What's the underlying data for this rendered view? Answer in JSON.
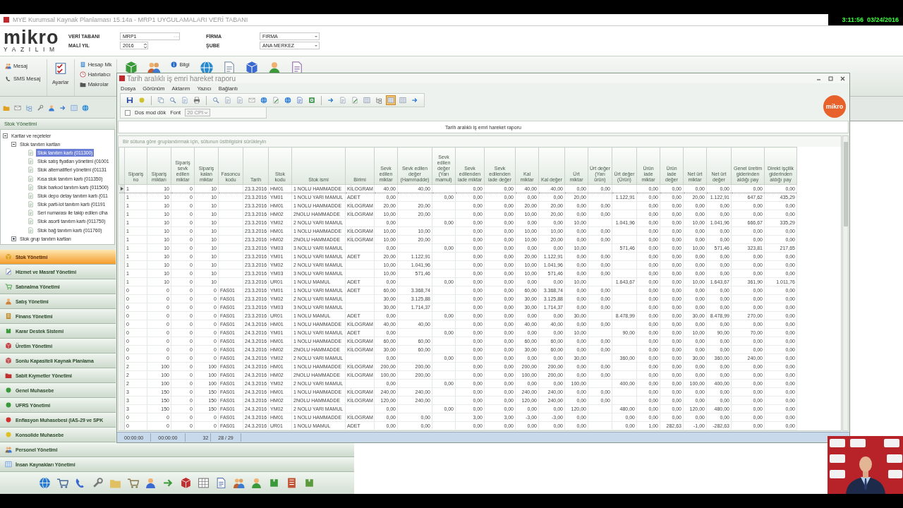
{
  "os_bar": {
    "time": "3:11:56",
    "date": "03/24/2016"
  },
  "window": {
    "title": "MYE Kurumsal Kaynak Planlaması 15.14a - MRP1  UYGULAMALARI VERİ TABANI"
  },
  "logo": {
    "brand": "mikro",
    "tagline": "YAZILIM"
  },
  "header_fields": [
    {
      "label": "VERİ TABANI",
      "value": "MRP1",
      "kind": "browse"
    },
    {
      "label": "MALİ YIL",
      "value": "2016",
      "kind": "spin"
    },
    {
      "label": "FİRMA",
      "value": "FIRMA",
      "kind": "dropdown"
    },
    {
      "label": "ŞUBE",
      "value": "ANA MERKEZ",
      "kind": "dropdown"
    }
  ],
  "ribbon": {
    "messages": [
      {
        "label": "Mesaj"
      },
      {
        "label": "SMS Mesaj"
      }
    ],
    "settings": {
      "label": "Ayarlar"
    },
    "tools": [
      {
        "label": "Hesap Mk"
      },
      {
        "label": "Hatırlatıcı"
      },
      {
        "label": "Makrolar"
      }
    ],
    "info": {
      "label": "Bilgi"
    }
  },
  "sidebar": {
    "title": "Stok Yönetimi",
    "tree": [
      {
        "label": "Kartlar ve reçeteler",
        "expanded": true,
        "children": [
          {
            "label": "Stok tanıtım kartları",
            "expanded": true,
            "children": [
              {
                "label": "Stok tanıtım kartı (011300)",
                "selected": true
              },
              {
                "label": "Stok satış fiyatları yönetimi (01001",
                "selected": false
              },
              {
                "label": "Stok alternatifleri yönetimi (01131",
                "selected": false
              },
              {
                "label": "Kısa stok tanıtım kartı (011350)",
                "selected": false
              },
              {
                "label": "Stok barkod tanıtım kartı (011500)",
                "selected": false
              },
              {
                "label": "Stok depo detay tanıtım kartı (011",
                "selected": false
              },
              {
                "label": "Stok parti-lot tanıtım kartı (01191",
                "selected": false
              },
              {
                "label": "Seri numarası ile takip edilen ciha",
                "selected": false
              },
              {
                "label": "Stok asorti tanıtım kartı (011750)",
                "selected": false
              },
              {
                "label": "Stok bağ tanıtım kartı (011760)",
                "selected": false
              }
            ]
          },
          {
            "label": "Stok grup tanıtım kartları",
            "expanded": false
          }
        ]
      }
    ]
  },
  "nav": {
    "items": [
      {
        "label": "Stok Yönetimi",
        "selected": true
      },
      {
        "label": "Hizmet ve Masraf Yönetimi",
        "selected": false
      },
      {
        "label": "Satınalma Yönetimi",
        "selected": false
      },
      {
        "label": "Satış Yönetimi",
        "selected": false
      },
      {
        "label": "Finans Yönetimi",
        "selected": false
      },
      {
        "label": "Karar Destek Sistemi",
        "selected": false
      },
      {
        "label": "Üretim Yönetimi",
        "selected": false
      },
      {
        "label": "Sonlu Kapasiteli Kaynak Planlama",
        "selected": false
      },
      {
        "label": "Sabit Kıymetler Yönetimi",
        "selected": false
      },
      {
        "label": "Genel Muhasebe",
        "selected": false
      },
      {
        "label": "UFRS Yönetimi",
        "selected": false
      },
      {
        "label": "Enflasyon Muhasebesi (IAS-29 ve SPK",
        "selected": false
      },
      {
        "label": "Konsolide Muhasebe",
        "selected": false
      },
      {
        "label": "Personel Yönetimi",
        "selected": false
      },
      {
        "label": "İnsan Kaynakları Yönetimi",
        "selected": false
      }
    ]
  },
  "report_window": {
    "title": "Tarih aralıklı iş emri hareket raporu",
    "menu": [
      "Dosya",
      "Görünüm",
      "Aktarım",
      "Yazıcı",
      "Bağlantı"
    ],
    "toolbar": [
      {
        "kind": "save",
        "pressed": false
      },
      {
        "kind": "refresh",
        "pressed": false
      },
      {
        "kind": "separator"
      },
      {
        "kind": "copy",
        "pressed": false
      },
      {
        "kind": "search",
        "pressed": false
      },
      {
        "kind": "preview",
        "pressed": false
      },
      {
        "kind": "print",
        "pressed": false
      },
      {
        "kind": "separator"
      },
      {
        "kind": "search",
        "pressed": false
      },
      {
        "kind": "doc",
        "pressed": false
      },
      {
        "kind": "doc",
        "pressed": false
      },
      {
        "kind": "envelope",
        "pressed": false
      },
      {
        "kind": "globe",
        "pressed": false
      },
      {
        "kind": "edit",
        "pressed": false
      },
      {
        "kind": "globe",
        "pressed": false
      },
      {
        "kind": "word",
        "pressed": false
      },
      {
        "kind": "excel",
        "pressed": false
      },
      {
        "kind": "separator"
      },
      {
        "kind": "arrow",
        "pressed": false
      },
      {
        "kind": "doc",
        "pressed": false
      },
      {
        "kind": "edit",
        "pressed": false
      },
      {
        "kind": "grid",
        "pressed": false
      },
      {
        "kind": "tree",
        "pressed": false
      },
      {
        "kind": "grid",
        "pressed": true
      },
      {
        "kind": "grid",
        "pressed": false
      },
      {
        "kind": "arrow",
        "pressed": false
      }
    ],
    "dos_mode": {
      "label": "Dos mod dök",
      "checked": false
    },
    "font": {
      "label": "Font",
      "value": "20 CPI",
      "disabled": true
    },
    "logo": "mikro",
    "caption": "Tarih aralıklı iş emri hareket raporu",
    "group_hint": "Bir sütuna göre gruplandırmak için, sütunun üstbilgisini sürükleyin",
    "table": {
      "columns": [
        "Sipariş no",
        "Sipariş miktarı",
        "Sipariş sevk edilen miktar",
        "Sipariş kalan miktar",
        "Fasoncu kodu",
        "Tarih",
        "Stok kodu",
        "Stok ismi",
        "Birimi",
        "Sevk edilen miktar",
        "Sevk edilen değer (Hammadde)",
        "Sevk edilen değer (Yarı mamul)",
        "Sevk edilenden iade miktar",
        "Sevk edilenden iade değer",
        "Kal miktar",
        "Kal değer",
        "Ürt miktar",
        "Ürt değer (Yarı ürün)",
        "Ürt değer (Ürün)",
        "Ürün iade miktar",
        "Ürün iade değer",
        "Net ürt miktar",
        "Net ürt değer",
        "Genel üretim giderinden aldığı pay",
        "Direkt işçilik giderinden aldığı pay"
      ],
      "rows": [
        {
          "selected": true,
          "cells": [
            "1",
            "10",
            "0",
            "10",
            null,
            "23.3.2016",
            "HM01",
            "1 NOLU HAMMADDE",
            "KİLOGRAM",
            "40,00",
            "40,00",
            null,
            "0,00",
            "0,00",
            "40,00",
            "40,00",
            "0,00",
            "0,00",
            null,
            "0,00",
            "0,00",
            "0,00",
            "0,00",
            "0,00",
            "0,00"
          ]
        },
        {
          "selected": false,
          "cells": [
            "1",
            "10",
            "0",
            "10",
            null,
            "23.3.2016",
            "YM01",
            "1 NOLU YARI MAMUL",
            "ADET",
            "0,00",
            null,
            "0,00",
            "0,00",
            "0,00",
            "0,00",
            "0,00",
            "20,00",
            null,
            "1.122,91",
            "0,00",
            "0,00",
            "20,00",
            "1.122,91",
            "647,62",
            "435,29"
          ]
        },
        {
          "selected": false,
          "cells": [
            "1",
            "10",
            "0",
            "10",
            null,
            "23.3.2016",
            "HM01",
            "1 NOLU HAMMADDE",
            "KİLOGRAM",
            "20,00",
            "20,00",
            null,
            "0,00",
            "0,00",
            "20,00",
            "20,00",
            "0,00",
            "0,00",
            null,
            "0,00",
            "0,00",
            "0,00",
            "0,00",
            "0,00",
            "0,00"
          ]
        },
        {
          "selected": false,
          "cells": [
            "1",
            "10",
            "0",
            "10",
            null,
            "23.3.2016",
            "HM02",
            "2NOLU HAMMADDE",
            "KİLOGRAM",
            "10,00",
            "20,00",
            null,
            "0,00",
            "0,00",
            "10,00",
            "20,00",
            "0,00",
            "0,00",
            null,
            "0,00",
            "0,00",
            "0,00",
            "0,00",
            "0,00",
            "0,00"
          ]
        },
        {
          "selected": false,
          "cells": [
            "1",
            "10",
            "0",
            "10",
            null,
            "23.3.2016",
            "YM02",
            "2 NOLU YARI MAMUL",
            null,
            "0,00",
            null,
            "0,00",
            "0,00",
            "0,00",
            "0,00",
            "0,00",
            "10,00",
            null,
            "1.041,96",
            "0,00",
            "0,00",
            "10,00",
            "1.041,96",
            "666,67",
            "335,29"
          ]
        },
        {
          "selected": false,
          "cells": [
            "1",
            "10",
            "0",
            "10",
            null,
            "23.3.2016",
            "HM01",
            "1 NOLU HAMMADDE",
            "KİLOGRAM",
            "10,00",
            "10,00",
            null,
            "0,00",
            "0,00",
            "10,00",
            "10,00",
            "0,00",
            "0,00",
            null,
            "0,00",
            "0,00",
            "0,00",
            "0,00",
            "0,00",
            "0,00"
          ]
        },
        {
          "selected": false,
          "cells": [
            "1",
            "10",
            "0",
            "10",
            null,
            "23.3.2016",
            "HM02",
            "2NOLU HAMMADDE",
            "KİLOGRAM",
            "10,00",
            "20,00",
            null,
            "0,00",
            "0,00",
            "10,00",
            "20,00",
            "0,00",
            "0,00",
            null,
            "0,00",
            "0,00",
            "0,00",
            "0,00",
            "0,00",
            "0,00"
          ]
        },
        {
          "selected": false,
          "cells": [
            "1",
            "10",
            "0",
            "10",
            null,
            "23.3.2016",
            "YM03",
            "3 NOLU YARI MAMUL",
            null,
            "0,00",
            null,
            "0,00",
            "0,00",
            "0,00",
            "0,00",
            "0,00",
            "10,00",
            null,
            "571,46",
            "0,00",
            "0,00",
            "10,00",
            "571,46",
            "323,81",
            "217,65"
          ]
        },
        {
          "selected": false,
          "cells": [
            "1",
            "10",
            "0",
            "10",
            null,
            "23.3.2016",
            "YM01",
            "1 NOLU YARI MAMUL",
            "ADET",
            "20,00",
            "1.122,91",
            null,
            "0,00",
            "0,00",
            "20,00",
            "1.122,91",
            "0,00",
            "0,00",
            null,
            "0,00",
            "0,00",
            "0,00",
            "0,00",
            "0,00",
            "0,00"
          ]
        },
        {
          "selected": false,
          "cells": [
            "1",
            "10",
            "0",
            "10",
            null,
            "23.3.2016",
            "YM02",
            "2 NOLU YARI MAMUL",
            null,
            "10,00",
            "1.041,96",
            null,
            "0,00",
            "0,00",
            "10,00",
            "1.041,96",
            "0,00",
            "0,00",
            null,
            "0,00",
            "0,00",
            "0,00",
            "0,00",
            "0,00",
            "0,00"
          ]
        },
        {
          "selected": false,
          "cells": [
            "1",
            "10",
            "0",
            "10",
            null,
            "23.3.2016",
            "YM03",
            "3 NOLU YARI MAMUL",
            null,
            "10,00",
            "571,46",
            null,
            "0,00",
            "0,00",
            "10,00",
            "571,46",
            "0,00",
            "0,00",
            null,
            "0,00",
            "0,00",
            "0,00",
            "0,00",
            "0,00",
            "0,00"
          ]
        },
        {
          "selected": false,
          "cells": [
            "1",
            "10",
            "0",
            "10",
            null,
            "23.3.2016",
            "UR01",
            "1 NOLU MAMUL",
            "ADET",
            "0,00",
            null,
            "0,00",
            "0,00",
            "0,00",
            "0,00",
            "0,00",
            "10,00",
            null,
            "1.643,67",
            "0,00",
            "0,00",
            "10,00",
            "1.643,67",
            "361,90",
            "1.011,76"
          ]
        },
        {
          "selected": false,
          "cells": [
            "0",
            "0",
            "0",
            "0",
            "FAS01",
            "23.3.2016",
            "YM01",
            "1 NOLU YARI MAMUL",
            "ADET",
            "60,00",
            "3.368,74",
            null,
            "0,00",
            "0,00",
            "60,00",
            "3.368,74",
            "0,00",
            "0,00",
            null,
            "0,00",
            "0,00",
            "0,00",
            "0,00",
            "0,00",
            "0,00"
          ]
        },
        {
          "selected": false,
          "cells": [
            "0",
            "0",
            "0",
            "0",
            "FAS01",
            "23.3.2016",
            "YM02",
            "2 NOLU YARI MAMUL",
            null,
            "30,00",
            "3.125,88",
            null,
            "0,00",
            "0,00",
            "30,00",
            "3.125,88",
            "0,00",
            "0,00",
            null,
            "0,00",
            "0,00",
            "0,00",
            "0,00",
            "0,00",
            "0,00"
          ]
        },
        {
          "selected": false,
          "cells": [
            "0",
            "0",
            "0",
            "0",
            "FAS01",
            "23.3.2016",
            "YM03",
            "3 NOLU YARI MAMUL",
            null,
            "30,00",
            "1.714,37",
            null,
            "0,00",
            "0,00",
            "30,00",
            "1.714,37",
            "0,00",
            "0,00",
            null,
            "0,00",
            "0,00",
            "0,00",
            "0,00",
            "0,00",
            "0,00"
          ]
        },
        {
          "selected": false,
          "cells": [
            "0",
            "0",
            "0",
            "0",
            "FAS01",
            "23.3.2016",
            "UR01",
            "1 NOLU MAMUL",
            "ADET",
            "0,00",
            null,
            "0,00",
            "0,00",
            "0,00",
            "0,00",
            "0,00",
            "30,00",
            null,
            "8.478,99",
            "0,00",
            "0,00",
            "30,00",
            "8.478,99",
            "270,00",
            "0,00"
          ]
        },
        {
          "selected": false,
          "cells": [
            "0",
            "0",
            "0",
            "0",
            "FAS01",
            "24.3.2016",
            "HM01",
            "1 NOLU HAMMADDE",
            "KİLOGRAM",
            "40,00",
            "40,00",
            null,
            "0,00",
            "0,00",
            "40,00",
            "40,00",
            "0,00",
            "0,00",
            null,
            "0,00",
            "0,00",
            "0,00",
            "0,00",
            "0,00",
            "0,00"
          ]
        },
        {
          "selected": false,
          "cells": [
            "0",
            "0",
            "0",
            "0",
            "FAS01",
            "24.3.2016",
            "YM01",
            "1 NOLU YARI MAMUL",
            "ADET",
            "0,00",
            null,
            "0,00",
            "0,00",
            "0,00",
            "0,00",
            "0,00",
            "10,00",
            null,
            "90,00",
            "0,00",
            "0,00",
            "10,00",
            "90,00",
            "70,00",
            "0,00"
          ]
        },
        {
          "selected": false,
          "cells": [
            "0",
            "0",
            "0",
            "0",
            "FAS01",
            "24.3.2016",
            "HM01",
            "1 NOLU HAMMADDE",
            "KİLOGRAM",
            "60,00",
            "60,00",
            null,
            "0,00",
            "0,00",
            "60,00",
            "60,00",
            "0,00",
            "0,00",
            null,
            "0,00",
            "0,00",
            "0,00",
            "0,00",
            "0,00",
            "0,00"
          ]
        },
        {
          "selected": false,
          "cells": [
            "0",
            "0",
            "0",
            "0",
            "FAS01",
            "24.3.2016",
            "HM02",
            "2NOLU HAMMADDE",
            "KİLOGRAM",
            "30,00",
            "60,00",
            null,
            "0,00",
            "0,00",
            "30,00",
            "60,00",
            "0,00",
            "0,00",
            null,
            "0,00",
            "0,00",
            "0,00",
            "0,00",
            "0,00",
            "0,00"
          ]
        },
        {
          "selected": false,
          "cells": [
            "0",
            "0",
            "0",
            "0",
            "FAS01",
            "24.3.2016",
            "YM02",
            "2 NOLU YARI MAMUL",
            null,
            "0,00",
            null,
            "0,00",
            "0,00",
            "0,00",
            "0,00",
            "0,00",
            "30,00",
            null,
            "360,00",
            "0,00",
            "0,00",
            "30,00",
            "360,00",
            "240,00",
            "0,00"
          ]
        },
        {
          "selected": false,
          "cells": [
            "2",
            "100",
            "0",
            "100",
            "FAS01",
            "24.3.2016",
            "HM01",
            "1 NOLU HAMMADDE",
            "KİLOGRAM",
            "200,00",
            "200,00",
            null,
            "0,00",
            "0,00",
            "200,00",
            "200,00",
            "0,00",
            "0,00",
            null,
            "0,00",
            "0,00",
            "0,00",
            "0,00",
            "0,00",
            "0,00"
          ]
        },
        {
          "selected": false,
          "cells": [
            "2",
            "100",
            "0",
            "100",
            "FAS01",
            "24.3.2016",
            "HM02",
            "2NOLU HAMMADDE",
            "KİLOGRAM",
            "100,00",
            "200,00",
            null,
            "0,00",
            "0,00",
            "100,00",
            "200,00",
            "0,00",
            "0,00",
            null,
            "0,00",
            "0,00",
            "0,00",
            "0,00",
            "0,00",
            "0,00"
          ]
        },
        {
          "selected": false,
          "cells": [
            "2",
            "100",
            "0",
            "100",
            "FAS01",
            "24.3.2016",
            "YM02",
            "2 NOLU YARI MAMUL",
            null,
            "0,00",
            null,
            "0,00",
            "0,00",
            "0,00",
            "0,00",
            "0,00",
            "100,00",
            null,
            "400,00",
            "0,00",
            "0,00",
            "100,00",
            "400,00",
            "0,00",
            "0,00"
          ]
        },
        {
          "selected": false,
          "cells": [
            "3",
            "150",
            "0",
            "150",
            "FAS01",
            "24.3.2016",
            "HM01",
            "1 NOLU HAMMADDE",
            "KİLOGRAM",
            "240,00",
            "240,00",
            null,
            "0,00",
            "0,00",
            "240,00",
            "240,00",
            "0,00",
            "0,00",
            null,
            "0,00",
            "0,00",
            "0,00",
            "0,00",
            "0,00",
            "0,00"
          ]
        },
        {
          "selected": false,
          "cells": [
            "3",
            "150",
            "0",
            "150",
            "FAS01",
            "24.3.2016",
            "HM02",
            "2NOLU HAMMADDE",
            "KİLOGRAM",
            "120,00",
            "240,00",
            null,
            "0,00",
            "0,00",
            "120,00",
            "240,00",
            "0,00",
            "0,00",
            null,
            "0,00",
            "0,00",
            "0,00",
            "0,00",
            "0,00",
            "0,00"
          ]
        },
        {
          "selected": false,
          "cells": [
            "3",
            "150",
            "0",
            "150",
            "FAS01",
            "24.3.2016",
            "YM02",
            "2 NOLU YARI MAMUL",
            null,
            "0,00",
            null,
            "0,00",
            "0,00",
            "0,00",
            "0,00",
            "0,00",
            "120,00",
            null,
            "480,00",
            "0,00",
            "0,00",
            "120,00",
            "480,00",
            "0,00",
            "0,00"
          ]
        },
        {
          "selected": false,
          "cells": [
            "0",
            "0",
            "0",
            "0",
            "FAS01",
            "24.3.2016",
            "HM01",
            "1 NOLU HAMMADDE",
            "KİLOGRAM",
            "0,00",
            "0,00",
            null,
            "3,00",
            "3,00",
            "-3,00",
            "-3,00",
            "0,00",
            null,
            "0,00",
            "0,00",
            "0,00",
            "0,00",
            "0,00",
            "0,00",
            "0,00"
          ]
        },
        {
          "selected": false,
          "cells": [
            "0",
            "0",
            "0",
            "0",
            "FAS01",
            "24.3.2016",
            "UR01",
            "1 NOLU MAMUL",
            "ADET",
            "0,00",
            "0,00",
            null,
            "0,00",
            "0,00",
            "0,00",
            "0,00",
            "0,00",
            null,
            "0,00",
            "1,00",
            "282,63",
            "-1,00",
            "-282,63",
            "0,00",
            "0,00"
          ]
        }
      ]
    },
    "status_bar": [
      "00:00:00",
      "00:00:00",
      "32",
      "28 / 29"
    ]
  }
}
